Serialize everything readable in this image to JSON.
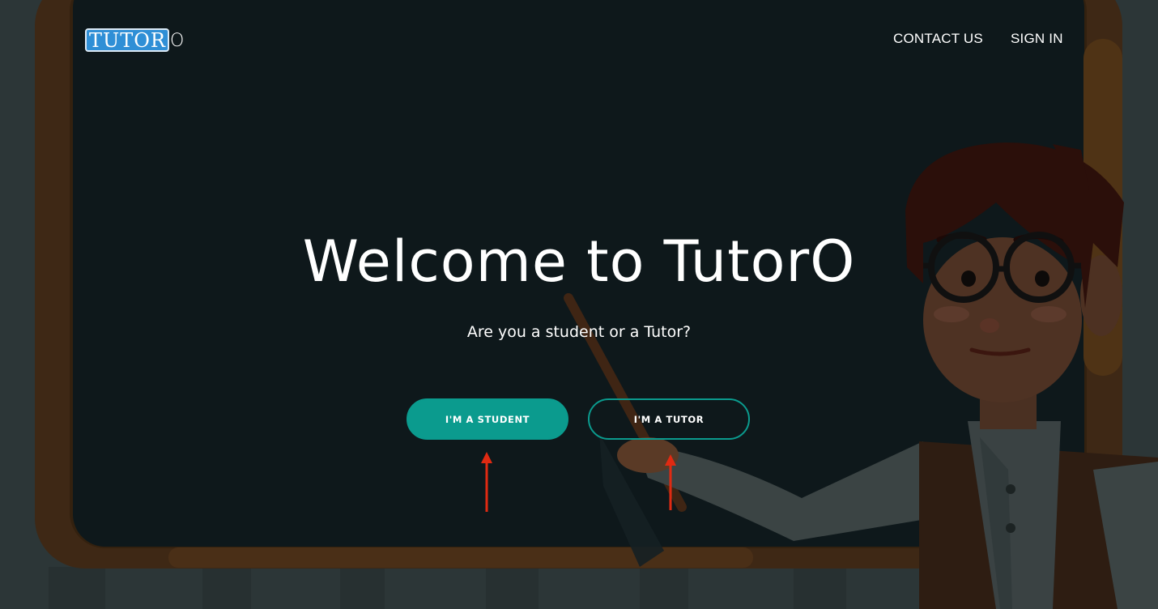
{
  "header": {
    "logo_boxed": "TUTOR",
    "logo_tail": "O",
    "nav_links": [
      "CONTACT US",
      "SIGN IN"
    ]
  },
  "hero": {
    "title": "Welcome to TutorO",
    "subtitle": "Are you a student or a Tutor?",
    "student_button": "I'M A STUDENT",
    "tutor_button": "I'M A TUTOR"
  },
  "colors": {
    "accent_teal": "#0b9b8e",
    "logo_blue": "#2f8fd6",
    "board_background": "#0f181b",
    "board_frame": "#3d2714",
    "annotation_arrow": "#e02a12"
  },
  "icons": [
    "teacher-illustration",
    "arrow-up-icon"
  ]
}
